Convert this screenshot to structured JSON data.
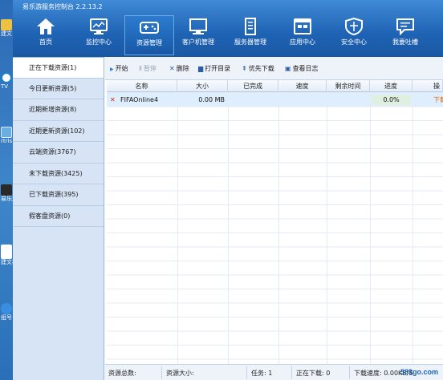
{
  "desktop": {
    "items": [
      {
        "label": "建文",
        "icon": "folder-icon",
        "color": "#f0c040"
      },
      {
        "label": "TV",
        "icon": "teamviewer-icon",
        "color": "#1a7fd1"
      },
      {
        "label": "rtris",
        "icon": "monitor-icon",
        "color": "#6aaee0"
      },
      {
        "label": "易乐游",
        "icon": "app-icon",
        "color": "#2a2a2a"
      },
      {
        "label": "建文档",
        "icon": "document-icon",
        "color": "#ffffff"
      },
      {
        "label": "组号",
        "icon": "ie-icon",
        "color": "#3a8ee0"
      }
    ]
  },
  "app": {
    "title": "易乐游服务控制台 2.2.13.2",
    "nav": [
      {
        "label": "首页",
        "icon": "home-icon",
        "active": false
      },
      {
        "label": "监控中心",
        "icon": "monitor-icon",
        "active": false
      },
      {
        "label": "资源管理",
        "icon": "gamepad-icon",
        "active": true
      },
      {
        "label": "客户机管理",
        "icon": "computer-icon",
        "active": false
      },
      {
        "label": "服务器管理",
        "icon": "server-icon",
        "active": false
      },
      {
        "label": "应用中心",
        "icon": "apps-icon",
        "active": false
      },
      {
        "label": "安全中心",
        "icon": "shield-icon",
        "active": false
      },
      {
        "label": "我要吐槽",
        "icon": "chat-icon",
        "active": false
      }
    ]
  },
  "sidebar": {
    "items": [
      {
        "label": "正在下载资源(1)",
        "active": true
      },
      {
        "label": "今日更新资源(5)",
        "active": false
      },
      {
        "label": "近期新增资源(8)",
        "active": false
      },
      {
        "label": "近期更新资源(102)",
        "active": false
      },
      {
        "label": "云端资源(3767)",
        "active": false
      },
      {
        "label": "未下载资源(3425)",
        "active": false
      },
      {
        "label": "已下载资源(395)",
        "active": false
      },
      {
        "label": "假客盘资源(0)",
        "active": false
      }
    ]
  },
  "actions": [
    {
      "label": "开始",
      "icon": "play-icon",
      "glyph": "▶",
      "disabled": false
    },
    {
      "label": "暂停",
      "icon": "pause-icon",
      "glyph": "Ⅱ",
      "disabled": true
    },
    {
      "label": "删除",
      "icon": "delete-icon",
      "glyph": "✕",
      "disabled": false
    },
    {
      "label": "打开目录",
      "icon": "folder-icon",
      "glyph": "▆",
      "disabled": false
    },
    {
      "label": "优先下载",
      "icon": "priority-icon",
      "glyph": "⇞",
      "disabled": false
    },
    {
      "label": "查看日志",
      "icon": "log-icon",
      "glyph": "▣",
      "disabled": false
    }
  ],
  "table": {
    "columns": [
      "名称",
      "大小",
      "已完成",
      "速度",
      "剩余时间",
      "进度",
      "操"
    ],
    "rows": [
      {
        "icon": "cancel-icon",
        "name": "FIFAOnline4",
        "size": "0.00 MB",
        "done": "",
        "speed": "",
        "remaining": "",
        "progress": "0.0%",
        "progress_value": 0.0,
        "action": "下载"
      }
    ]
  },
  "status": {
    "total_label": "资源总数:",
    "size_label": "资源大小:",
    "tasks": "任务: 1",
    "downloading": "正在下载: 0",
    "speed": "下载速度: 0.00KB/S"
  },
  "watermark": "583go.com",
  "colors": {
    "header": "#1f63b4",
    "accent_red": "#d2261b",
    "progress_bg": "#dff0e0",
    "action_link": "#d86a10"
  }
}
